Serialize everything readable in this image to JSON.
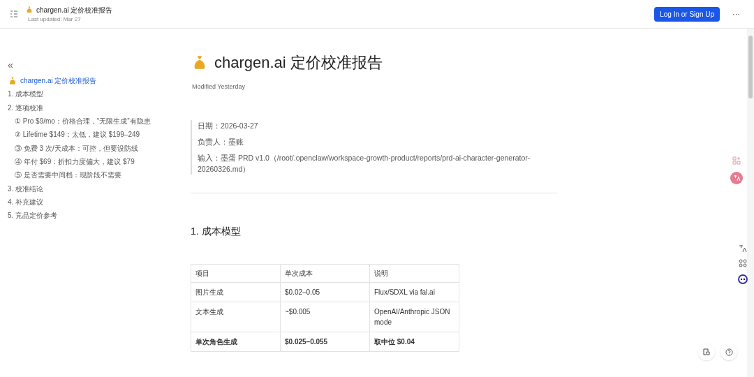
{
  "header": {
    "title": "chargen.ai 定价校准报告",
    "subtitle": "Last updated: Mar 27",
    "login_button": "Log In or Sign Up",
    "more": "···"
  },
  "toc": {
    "collapse": "«",
    "items": [
      {
        "label": "chargen.ai 定价校准报告",
        "selected": true,
        "kind": "title"
      },
      {
        "label": "1. 成本模型",
        "selected": false,
        "kind": "section"
      },
      {
        "label": "2. 逐项校准",
        "selected": false,
        "kind": "section",
        "children": [
          {
            "label": "① Pro $9/mo：价格合理，“无限生成”有隐患",
            "selected": false
          },
          {
            "label": "② Lifetime $149：太低，建议 $199–249",
            "selected": false
          },
          {
            "label": "③ 免费 3 次/天成本：可控，但要设防线",
            "selected": false
          },
          {
            "label": "④ 年付 $69：折扣力度偏大，建议 $79",
            "selected": false
          },
          {
            "label": "⑤ 是否需要中间档：现阶段不需要",
            "selected": false
          }
        ]
      },
      {
        "label": "3. 校准结论",
        "selected": false,
        "kind": "section"
      },
      {
        "label": "4. 补充建议",
        "selected": false,
        "kind": "section"
      },
      {
        "label": "5. 竞品定价参考",
        "selected": false,
        "kind": "section"
      }
    ]
  },
  "doc": {
    "title": "chargen.ai 定价校准报告",
    "modified": "Modified Yesterday",
    "meta": [
      "日期：2026-03-27",
      "负责人：墨账",
      "输入：墨蛋 PRD v1.0（/root/.openclaw/workspace-growth-product/reports/prd-ai-character-generator-20260326.md）"
    ],
    "section_heading": "1. 成本模型",
    "table": {
      "columns": [
        "项目",
        "单次成本",
        "说明"
      ],
      "rows": [
        {
          "cells": [
            "图片生成",
            "$0.02–0.05",
            "Flux/SDXL via fal.ai"
          ],
          "bold": false
        },
        {
          "cells": [
            "文本生成",
            "~$0.005",
            "OpenAI/Anthropic JSON mode"
          ],
          "bold": false
        },
        {
          "cells": [
            "单次角色生成",
            "$0.025–0.055",
            "取中位 $0.04"
          ],
          "bold": true
        }
      ]
    }
  }
}
